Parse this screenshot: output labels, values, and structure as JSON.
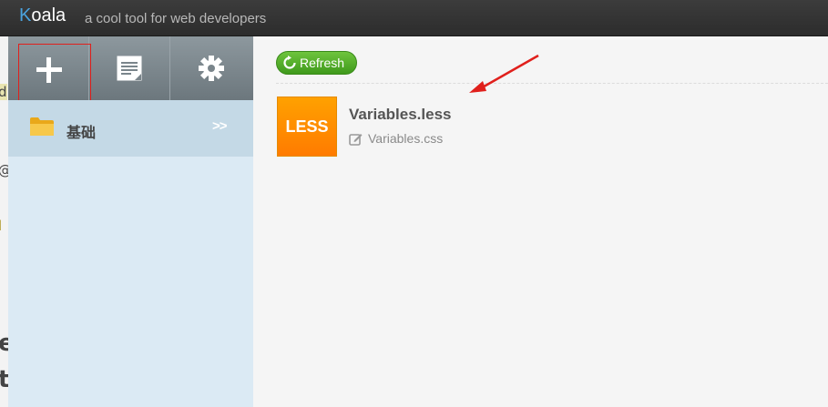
{
  "app": {
    "name_first": "K",
    "name_rest": "oala",
    "tagline": "a cool tool for web developers"
  },
  "background_fragments": [
    "d",
    "@",
    "l",
    "e",
    "t"
  ],
  "toolbar": {
    "buttons": [
      {
        "name": "add",
        "icon": "plus-icon"
      },
      {
        "name": "log",
        "icon": "document-icon"
      },
      {
        "name": "settings",
        "icon": "gear-icon"
      }
    ]
  },
  "sidebar": {
    "project": {
      "name": "基础",
      "icon": "folder-icon",
      "chevron": ">>"
    }
  },
  "main": {
    "refresh_label": "Refresh",
    "files": [
      {
        "type_badge": "LESS",
        "name": "Variables.less",
        "output": "Variables.css"
      }
    ]
  },
  "colors": {
    "titlebar": "#333333",
    "accent_k": "#4aa3df",
    "refresh_green": "#4caf28",
    "less_orange": "#ff8c00",
    "highlight_red": "#e0201c"
  }
}
